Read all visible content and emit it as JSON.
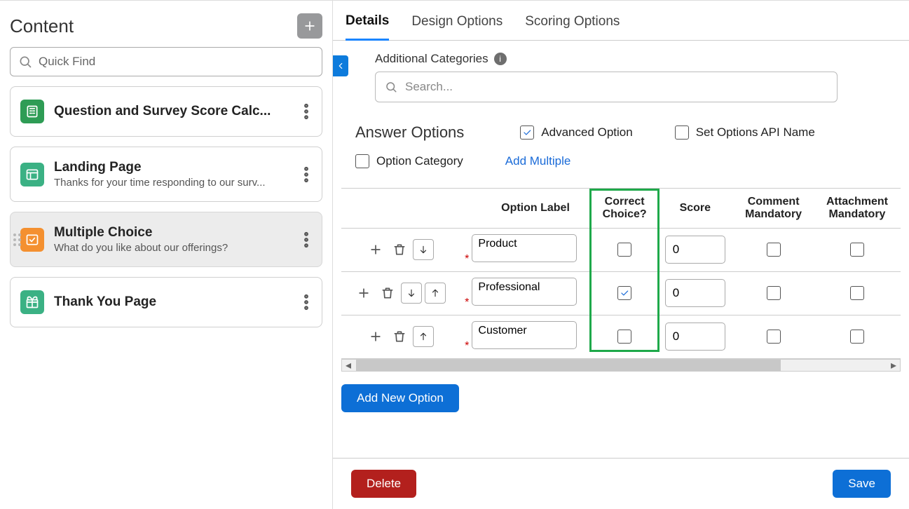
{
  "left": {
    "title": "Content",
    "search_placeholder": "Quick Find",
    "items": [
      {
        "title": "Question and Survey Score Calc...",
        "sub": "",
        "icon": "calc"
      },
      {
        "title": "Landing Page",
        "sub": "Thanks for your time responding to our surv...",
        "icon": "layout"
      },
      {
        "title": "Multiple Choice",
        "sub": "What do you like about our offerings?",
        "icon": "choice",
        "selected": true
      },
      {
        "title": "Thank You Page",
        "sub": "",
        "icon": "gift"
      }
    ]
  },
  "tabs": {
    "details": "Details",
    "design": "Design Options",
    "scoring": "Scoring Options",
    "active": "details"
  },
  "categories": {
    "label": "Additional Categories",
    "placeholder": "Search..."
  },
  "answer": {
    "heading": "Answer Options",
    "advanced_label": "Advanced Option",
    "advanced_checked": true,
    "set_api_label": "Set Options API Name",
    "set_api_checked": false,
    "option_category_label": "Option Category",
    "option_category_checked": false,
    "add_multiple": "Add Multiple"
  },
  "table": {
    "headers": {
      "option_label": "Option Label",
      "correct": "Correct Choice?",
      "score": "Score",
      "comment": "Comment Mandatory",
      "attachment": "Attachment Mandatory"
    },
    "rows": [
      {
        "label": "Product",
        "correct": false,
        "score": "0",
        "comment": false,
        "attachment": false,
        "up": false,
        "down": true
      },
      {
        "label": "Professional",
        "correct": true,
        "score": "0",
        "comment": false,
        "attachment": false,
        "up": true,
        "down": true
      },
      {
        "label": "Customer",
        "correct": false,
        "score": "0",
        "comment": false,
        "attachment": false,
        "up": true,
        "down": false
      }
    ]
  },
  "buttons": {
    "add_new": "Add New Option",
    "delete": "Delete",
    "save": "Save"
  }
}
